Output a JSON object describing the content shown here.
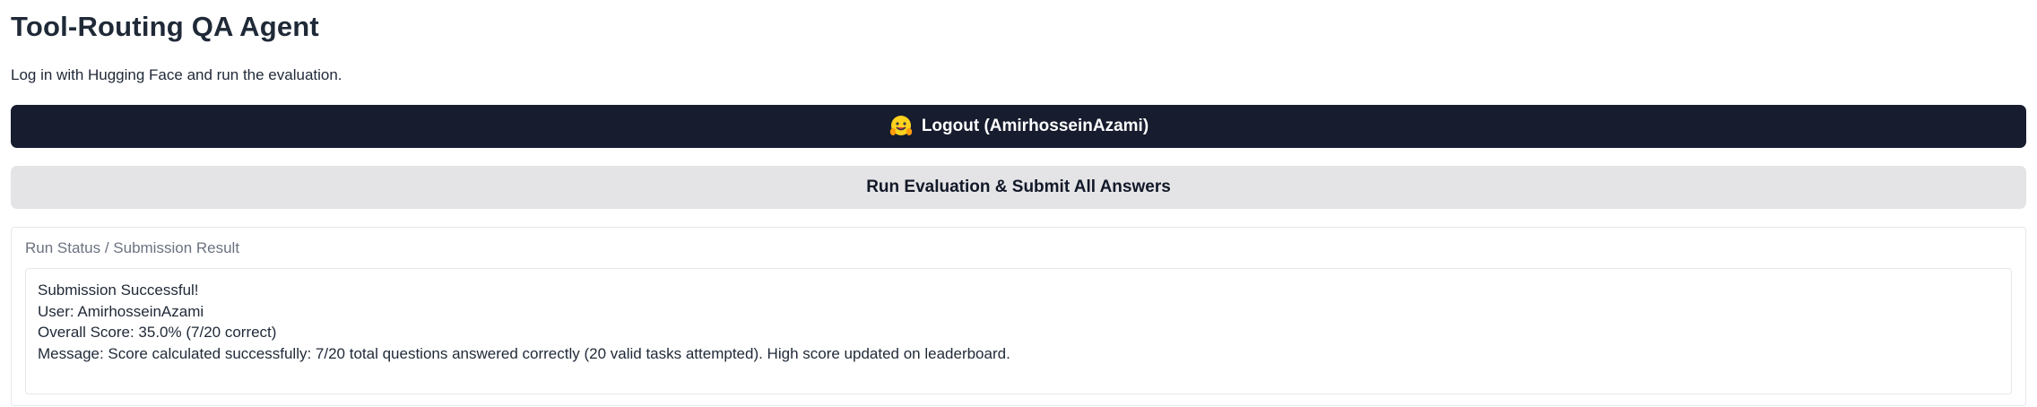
{
  "header": {
    "title": "Tool-Routing QA Agent",
    "subtitle": "Log in with Hugging Face and run the evaluation."
  },
  "buttons": {
    "logout_label": "Logout (AmirhosseinAzami)",
    "logout_icon": "hugging-face-icon",
    "run_label": "Run Evaluation & Submit All Answers"
  },
  "result": {
    "label": "Run Status / Submission Result",
    "lines": [
      "Submission Successful!",
      "User: AmirhosseinAzami",
      "Overall Score: 35.0% (7/20 correct)",
      "Message: Score calculated successfully: 7/20 total questions answered correctly (20 valid tasks attempted). High score updated on leaderboard."
    ]
  },
  "colors": {
    "logout_bg": "#171c2e",
    "run_bg": "#e4e4e7",
    "text": "#1f2937",
    "muted": "#6b7280"
  }
}
